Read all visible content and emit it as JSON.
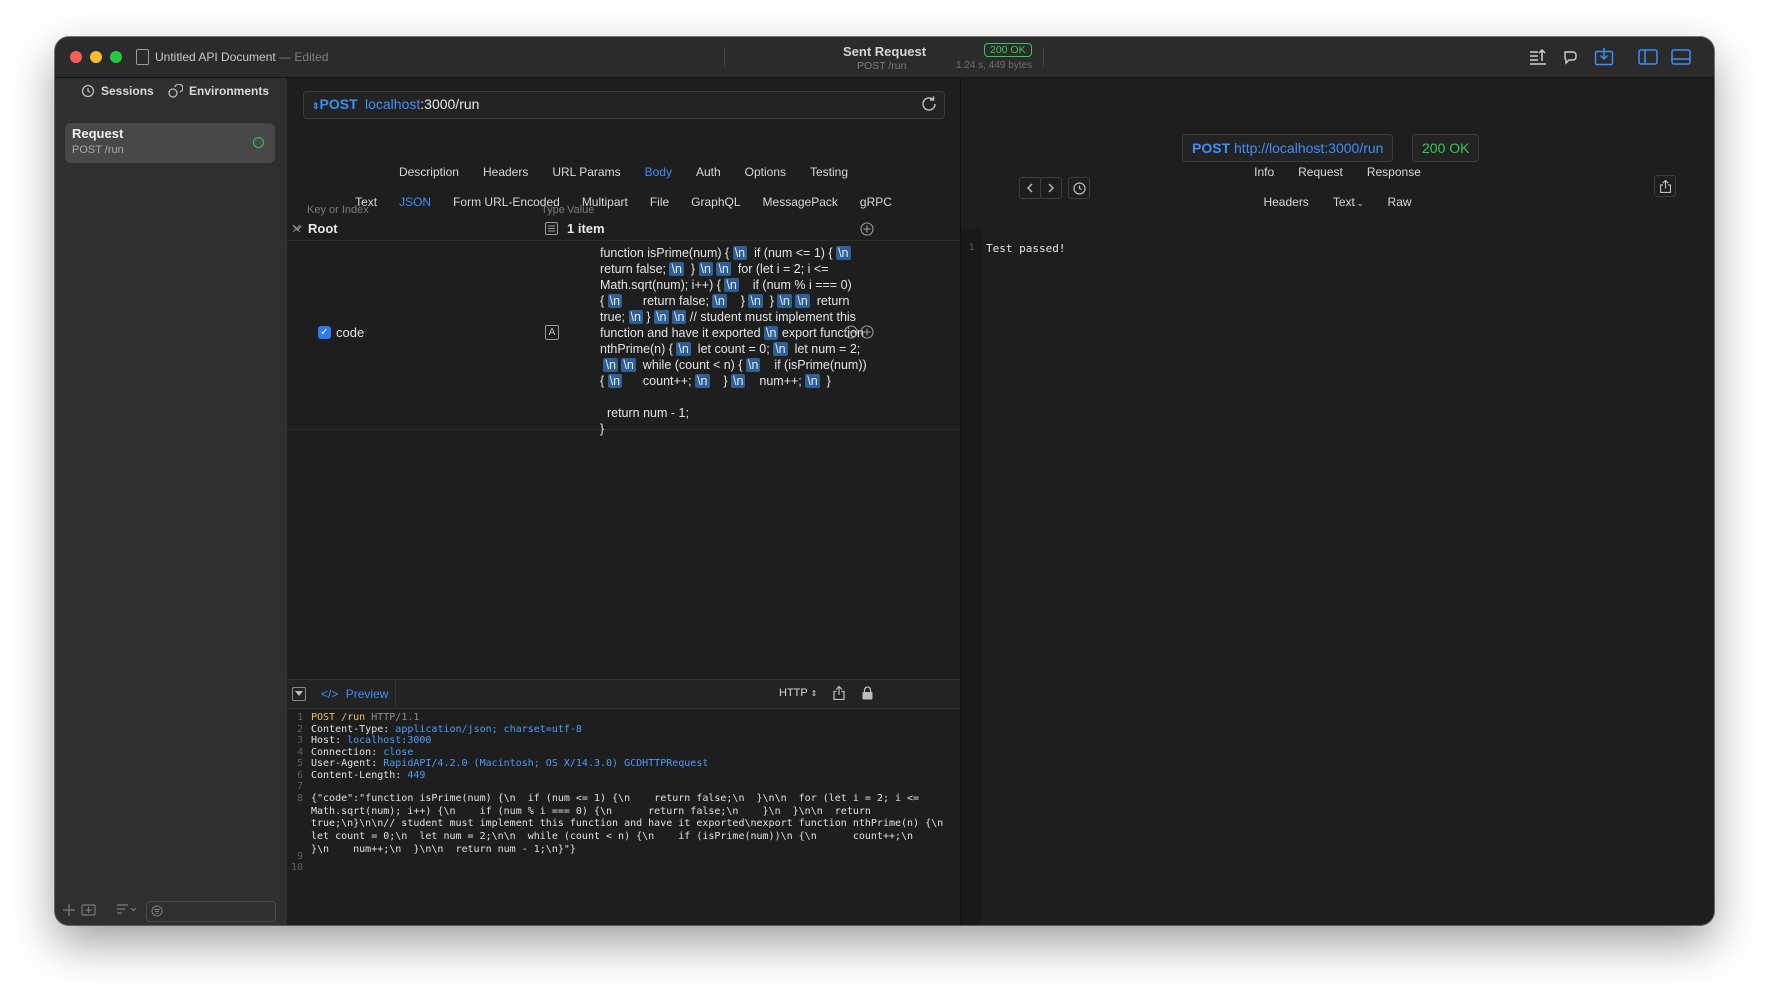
{
  "window": {
    "doc_title": "Untitled API Document",
    "edited": "— Edited"
  },
  "titlebar": {
    "sent_title": "Sent Request",
    "sent_sub": "POST /run",
    "status_badge": "200 OK",
    "meta": "1.24 s, 449 bytes"
  },
  "sidebar": {
    "tabs": [
      "Sessions",
      "Environments"
    ],
    "request": {
      "name": "Request",
      "sub": "POST /run"
    }
  },
  "request": {
    "method": "POST",
    "host": "localhost",
    "path": ":3000/run",
    "tabs": [
      "Description",
      "Headers",
      "URL Params",
      "Body",
      "Auth",
      "Options",
      "Testing"
    ],
    "active_tab": "Body",
    "body_types": [
      "Text",
      "JSON",
      "Form URL-Encoded",
      "Multipart",
      "File",
      "GraphQL",
      "MessagePack",
      "gRPC"
    ],
    "active_body_type": "JSON",
    "table": {
      "key_header": "Key or Index",
      "type_header": "Type",
      "value_header": "Value",
      "root_label": "Root",
      "root_value": "1 item",
      "row_key": "code",
      "row_type_glyph": "A",
      "code_lines": [
        "function isPrime(num) { \\n  if (num <= 1) { \\n",
        "return false; \\n  } \\n \\n  for (let i = 2; i <=",
        "Math.sqrt(num); i++) { \\n    if (num % i === 0)",
        "{ \\n      return false; \\n    } \\n  } \\n \\n  return",
        "true; \\n } \\n \\n // student must implement this",
        "function and have it exported \\n export function",
        "nthPrime(n) { \\n  let count = 0; \\n  let num = 2;",
        " \\n \\n  while (count < n) { \\n    if (isPrime(num))",
        "{ \\n      count++; \\n    } \\n    num++; \\n  }",
        "",
        "  return num - 1;",
        "}"
      ]
    }
  },
  "preview": {
    "tab": "Preview",
    "format": "HTTP",
    "lines": [
      {
        "n": "1",
        "a": "POST",
        "b": " /run",
        "c": " HTTP/1.1"
      },
      {
        "n": "2",
        "a": "Content-Type: ",
        "b": "application/json; charset=utf-8"
      },
      {
        "n": "3",
        "a": "Host: ",
        "b": "localhost:3000"
      },
      {
        "n": "4",
        "a": "Connection: ",
        "b": "close"
      },
      {
        "n": "5",
        "a": "User-Agent: ",
        "b": "RapidAPI/4.2.0 (Macintosh; OS X/14.3.0) GCDHTTPRequest"
      },
      {
        "n": "6",
        "a": "Content-Length: ",
        "b": "449"
      },
      {
        "n": "7",
        "a": ""
      },
      {
        "n": "8",
        "a": "{\"code\":\"function isPrime(num) {\\n  if (num <= 1) {\\n    return false;\\n  }\\n\\n  for (let i = 2; i <= Math.sqrt(num); i++) {\\n    if (num % i === 0) {\\n      return false;\\n    }\\n  }\\n\\n  return true;\\n}\\n\\n// student must implement this function and have it exported\\nexport function nthPrime(n) {\\n  let count = 0;\\n  let num = 2;\\n\\n  while (count < n) {\\n    if (isPrime(num))\\n {\\n      count++;\\n    }\\n    num++;\\n  }\\n\\n  return num - 1;\\n}\"}"
      },
      {
        "n": "9",
        "a": ""
      },
      {
        "n": "10",
        "a": ""
      }
    ]
  },
  "response": {
    "method": "POST",
    "url": "http://localhost:3000/run",
    "status": "200 OK",
    "tabs": [
      "Info",
      "Request",
      "Response"
    ],
    "active_tab": "Response",
    "sub_tabs": [
      "Headers",
      "Text",
      "Raw"
    ],
    "active_sub_tab": "Text",
    "line_no": "1",
    "body": "Test passed!"
  },
  "colors": {
    "accent": "#3e8ef7",
    "success": "#33c759",
    "background": "#1e1e1e",
    "sidebar": "#2f2f2f"
  }
}
